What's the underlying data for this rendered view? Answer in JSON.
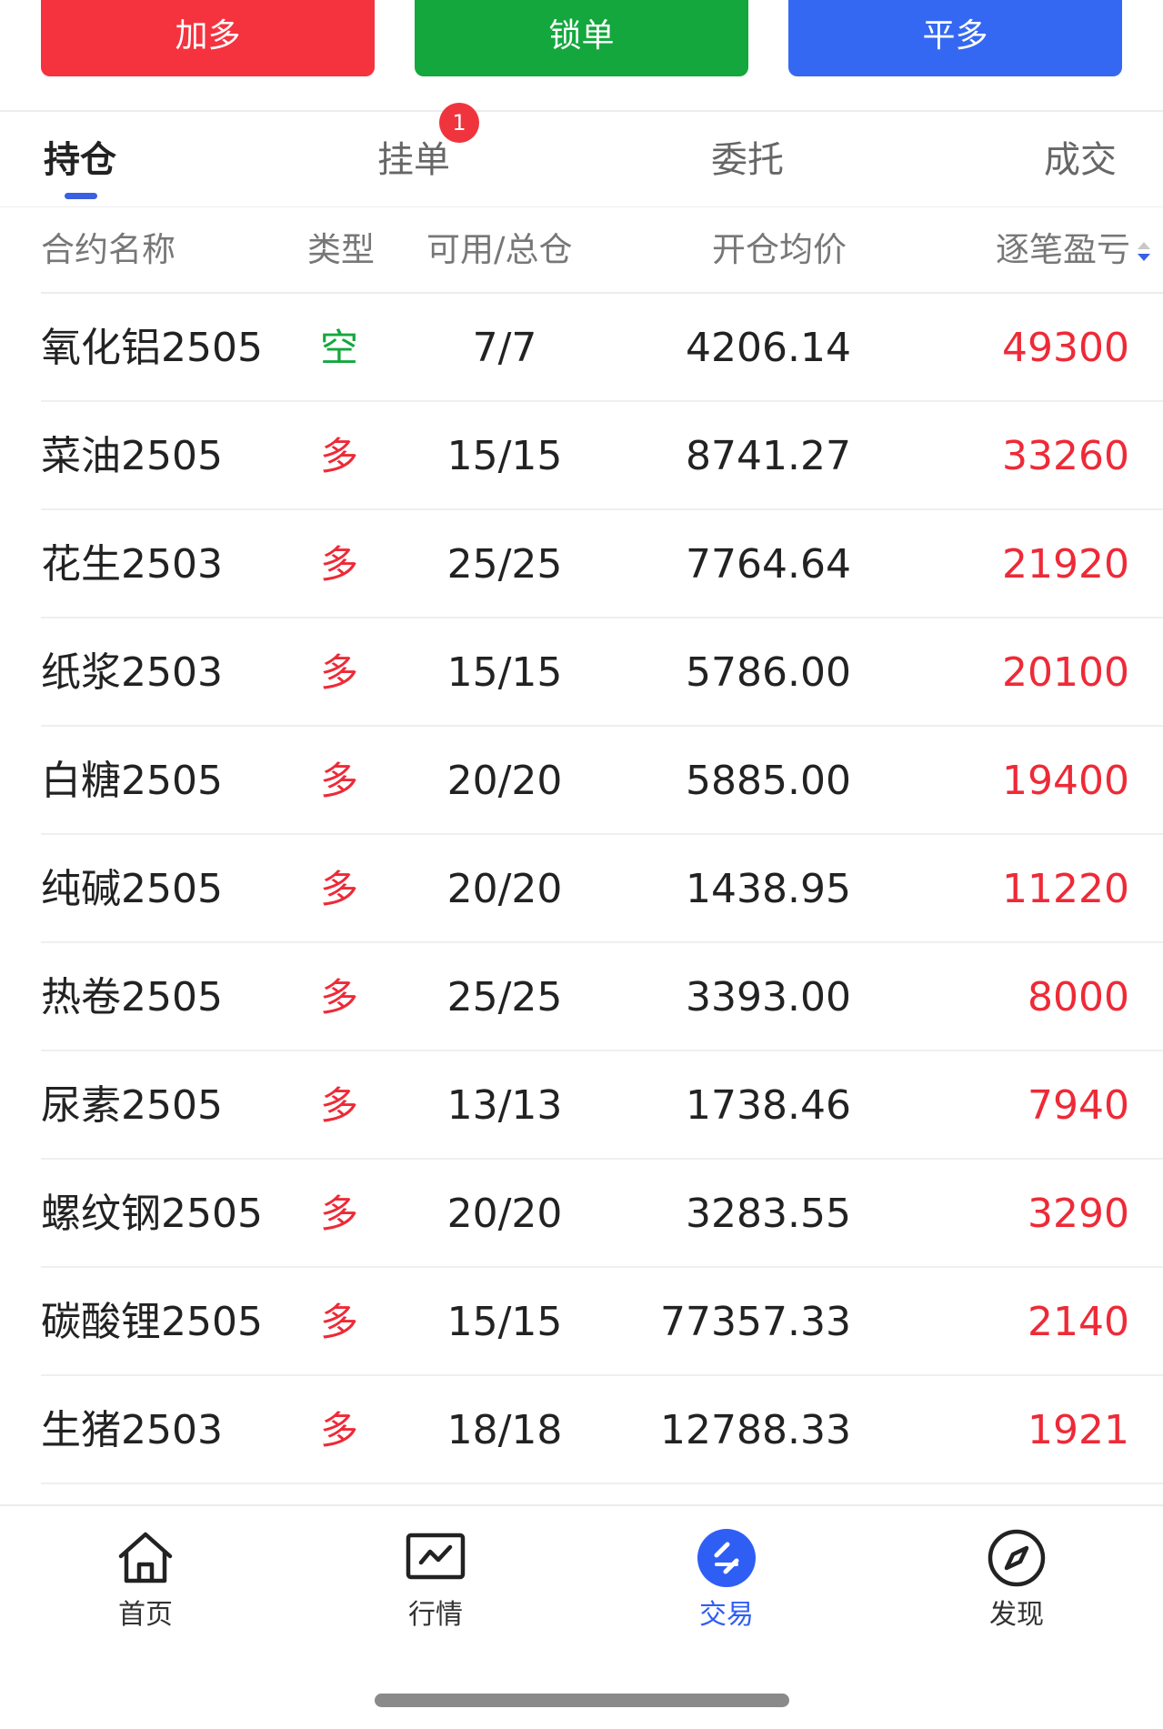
{
  "actions": {
    "add_long": {
      "label": "加多",
      "color": "#f5333f"
    },
    "lock": {
      "label": "锁单",
      "color": "#14a73e"
    },
    "close_long": {
      "label": "平多",
      "color": "#3568f2"
    }
  },
  "tabs": [
    {
      "label": "持仓",
      "active": true
    },
    {
      "label": "挂单",
      "badge": "1"
    },
    {
      "label": "委托"
    },
    {
      "label": "成交"
    }
  ],
  "table": {
    "headers": {
      "name": "合约名称",
      "type": "类型",
      "qty": "可用/总仓",
      "price": "开仓均价",
      "pnl": "逐笔盈亏"
    },
    "rows": [
      {
        "name": "氧化铝2505",
        "type": "空",
        "qty": "7/7",
        "price": "4206.14",
        "pnl": "49300"
      },
      {
        "name": "菜油2505",
        "type": "多",
        "qty": "15/15",
        "price": "8741.27",
        "pnl": "33260"
      },
      {
        "name": "花生2503",
        "type": "多",
        "qty": "25/25",
        "price": "7764.64",
        "pnl": "21920"
      },
      {
        "name": "纸浆2503",
        "type": "多",
        "qty": "15/15",
        "price": "5786.00",
        "pnl": "20100"
      },
      {
        "name": "白糖2505",
        "type": "多",
        "qty": "20/20",
        "price": "5885.00",
        "pnl": "19400"
      },
      {
        "name": "纯碱2505",
        "type": "多",
        "qty": "20/20",
        "price": "1438.95",
        "pnl": "11220"
      },
      {
        "name": "热卷2505",
        "type": "多",
        "qty": "25/25",
        "price": "3393.00",
        "pnl": "8000"
      },
      {
        "name": "尿素2505",
        "type": "多",
        "qty": "13/13",
        "price": "1738.46",
        "pnl": "7940"
      },
      {
        "name": "螺纹钢2505",
        "type": "多",
        "qty": "20/20",
        "price": "3283.55",
        "pnl": "3290"
      },
      {
        "name": "碳酸锂2505",
        "type": "多",
        "qty": "15/15",
        "price": "77357.33",
        "pnl": "2140"
      },
      {
        "name": "生猪2503",
        "type": "多",
        "qty": "18/18",
        "price": "12788.33",
        "pnl": "1921"
      }
    ]
  },
  "nav": [
    {
      "label": "首页",
      "icon": "home-icon"
    },
    {
      "label": "行情",
      "icon": "chart-icon"
    },
    {
      "label": "交易",
      "icon": "trade-icon",
      "active": true
    },
    {
      "label": "发现",
      "icon": "compass-icon"
    }
  ],
  "colors": {
    "long": "#ee2a37",
    "short": "#14a73e",
    "accent": "#2f5ef5"
  }
}
